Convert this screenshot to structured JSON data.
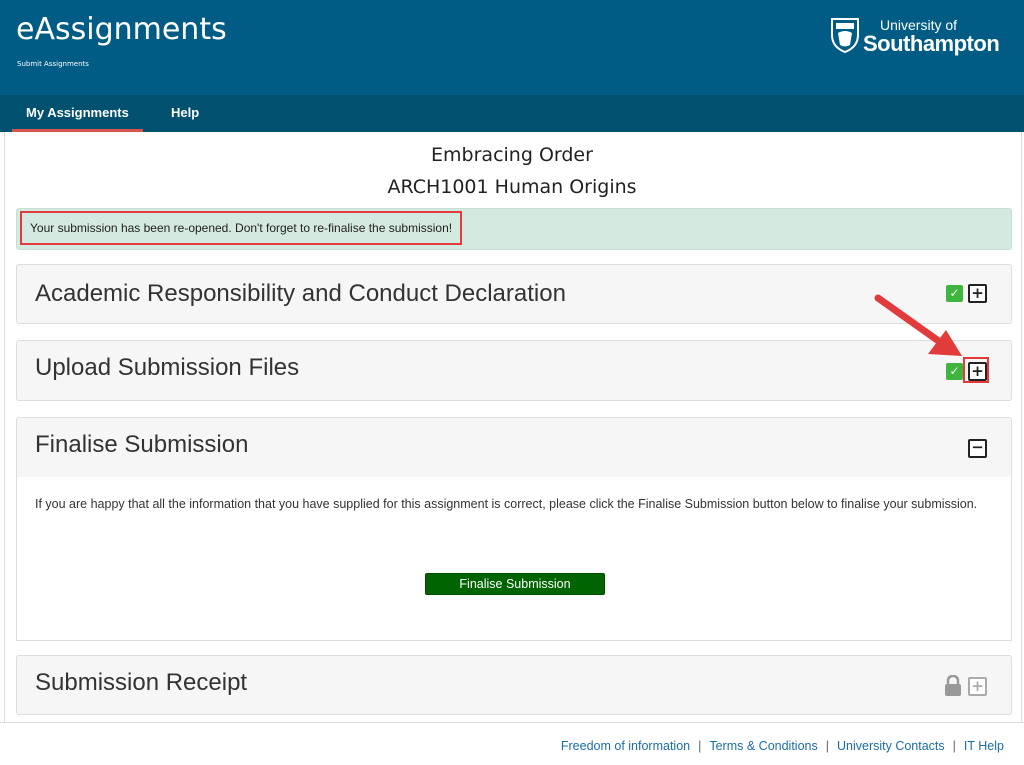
{
  "header": {
    "app_title": "eAssignments",
    "app_subtitle": "Submit Assignments",
    "logo_line1": "University of",
    "logo_line2": "Southampton"
  },
  "nav": {
    "tabs": [
      {
        "label": "My Assignments",
        "active": true
      },
      {
        "label": "Help",
        "active": false
      }
    ]
  },
  "assignment": {
    "title": "Embracing Order",
    "module": "ARCH1001 Human Origins"
  },
  "alert": {
    "message": "Your submission has been re-opened. Don't forget to re-finalise the submission!"
  },
  "sections": [
    {
      "title": "Academic Responsibility and Conduct Declaration",
      "completed": true,
      "state": "collapsed"
    },
    {
      "title": "Upload Submission Files",
      "completed": true,
      "state": "collapsed"
    },
    {
      "title": "Finalise Submission",
      "completed": false,
      "state": "expanded"
    },
    {
      "title": "Submission Receipt",
      "completed": false,
      "state": "locked"
    }
  ],
  "finalise": {
    "text": "If you are happy that all the information that you have supplied for this assignment is correct, please click the Finalise Submission button below to finalise your submission.",
    "button_label": "Finalise Submission"
  },
  "footer": {
    "links": [
      "Freedom of information",
      "Terms & Conditions",
      "University Contacts",
      "IT Help"
    ],
    "separator": "|"
  },
  "colors": {
    "header_bg": "#005c84",
    "nav_bg": "#005070",
    "alert_bg": "#d4e9df",
    "check_green": "#3fb53f",
    "button_green": "#006400",
    "annotation_red": "#e23b3b",
    "link_blue": "#1a6ea8"
  },
  "icons": {
    "check": "check-icon",
    "expand": "plus-square-icon",
    "collapse": "minus-square-icon",
    "lock": "lock-icon"
  }
}
